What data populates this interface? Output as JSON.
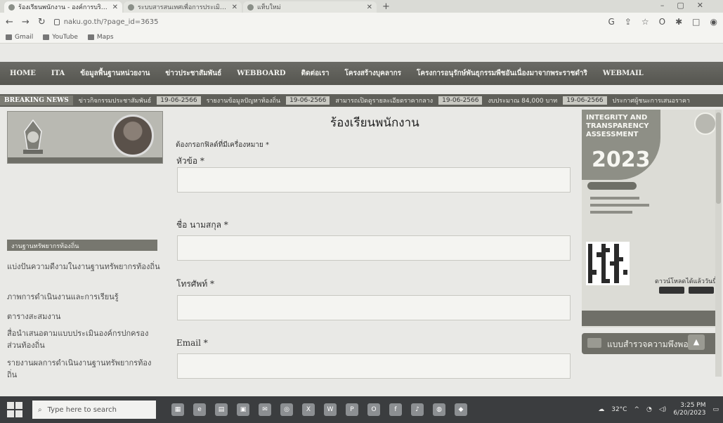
{
  "browser": {
    "tabs": [
      {
        "label": "ร้องเรียนพนักงาน - องค์การบริหารส่วน",
        "active": true
      },
      {
        "label": "ระบบสารสนเทศเพื่อการประเมินผลการ",
        "active": false
      },
      {
        "label": "แท็บใหม่",
        "active": false
      }
    ],
    "url": "naku.go.th/?page_id=3635",
    "bookmarks": [
      "Gmail",
      "YouTube",
      "Maps"
    ]
  },
  "site": {
    "nav": [
      "HOME",
      "ITA",
      "ข้อมูลพื้นฐานหน่วยงาน",
      "ข่าวประชาสัมพันธ์",
      "WEBBOARD",
      "ติดต่อเรา",
      "โครงสร้างบุคลากร",
      "โครงการอนุรักษ์พันธุกรรมพืชอันเนื่องมาจากพระราชดำริ",
      "WEBMAIL"
    ],
    "ticker": {
      "label": "BREAKING NEWS",
      "items": [
        {
          "text": "ข่าวกิจกรรมประชาสัมพันธ์",
          "date": "19-06-2566"
        },
        {
          "text": "รายงานข้อมูลปัญหาท้องถิ่น",
          "date": "19-06-2566"
        },
        {
          "text": "สามารถเปิดดูรายละเอียดราคากลาง",
          "date": "19-06-2566"
        },
        {
          "text": "งบประมาณ 84,000 บาท",
          "date": "19-06-2566"
        },
        {
          "text": "ประกาศผู้ชนะการเสนอราคา",
          "date": ""
        }
      ]
    }
  },
  "sidebar": {
    "heading": "งานฐานทรัพยากรท้องถิ่น",
    "items": [
      "แบ่งปันความดีงามในงานฐานทรัพยากรท้องถิ่น",
      "ภาพการดำเนินงานและการเรียนรู้",
      "ตารางสะสมงาน",
      "สื่อนำเสนอตามแบบประเมินองค์กรปกครองส่วนท้องถิ่น",
      "รายงานผลการดำเนินงานฐานทรัพยากรท้องถิ่น"
    ]
  },
  "form": {
    "title": "ร้องเรียนพนักงาน",
    "required_note": "ต้องกรอกฟิลด์ที่มีเครื่องหมาย *",
    "fields": [
      {
        "label": "หัวข้อ *",
        "value": ""
      },
      {
        "label": "ชื่อ นามสกุล *",
        "value": ""
      },
      {
        "label": "โทรศัพท์ *",
        "value": ""
      },
      {
        "label": "Email *",
        "value": ""
      }
    ]
  },
  "ita_banner": {
    "line1": "INTEGRITY AND",
    "line2": "TRANSPARENCY",
    "line3": "ASSESSMENT",
    "year": "2023",
    "download": "ดาวน์โหลดได้แล้ววันนี้"
  },
  "survey_button": "แบบสำรวจความพึงพอใจ",
  "taskbar": {
    "search_placeholder": "Type here to search",
    "weather": "32°C",
    "time": "3:25 PM",
    "date": "6/20/2023"
  }
}
